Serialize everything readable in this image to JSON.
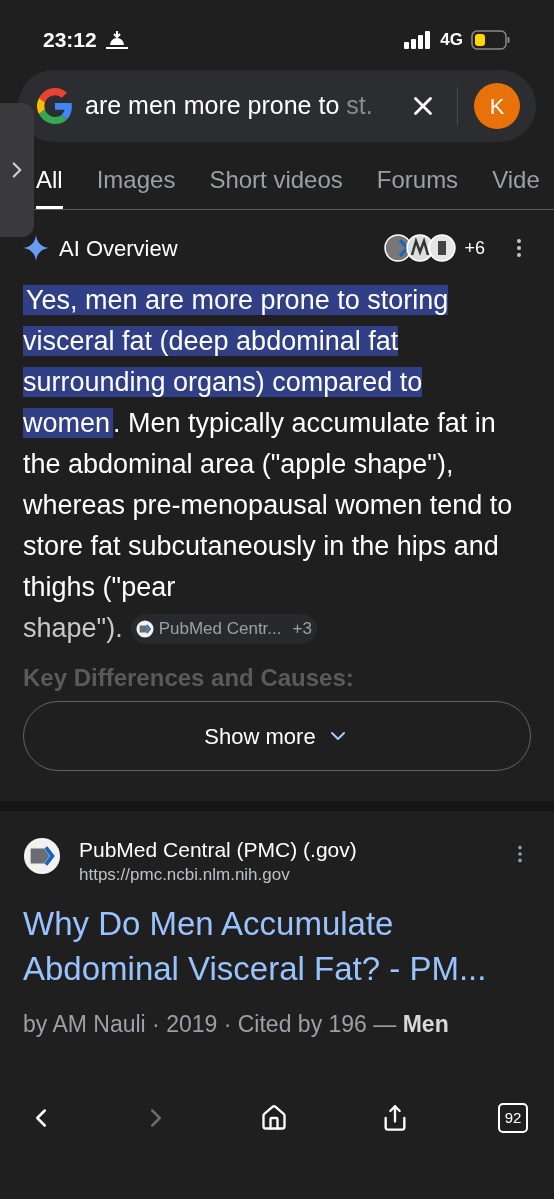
{
  "status_bar": {
    "time": "23:12",
    "network": "4G"
  },
  "search": {
    "query": "are men more prone to ",
    "query_faded": "st.",
    "avatar_letter": "K"
  },
  "tabs": [
    {
      "label": "All",
      "selected": true
    },
    {
      "label": "Images",
      "selected": false
    },
    {
      "label": "Short videos",
      "selected": false
    },
    {
      "label": "Forums",
      "selected": false
    },
    {
      "label": "Vide",
      "selected": false
    }
  ],
  "ai_overview": {
    "title": "AI Overview",
    "sources_more": "+6",
    "highlighted": "Yes, men are more prone to storing visceral fat (deep abdominal fat surrounding organs) compared to women",
    "rest": ". Men typically accumulate fat in the abdominal area (\"apple shape\"), whereas pre-menopausal women tend to store fat subcutaneously in the hips and thighs (\"pear",
    "tail": "shape\").",
    "citation": {
      "source": "PubMed Centr...",
      "more": "+3"
    },
    "faded_heading": "Key Differences and Causes:",
    "show_more": "Show more"
  },
  "result": {
    "site": "PubMed Central (PMC) (.gov)",
    "url": "https://pmc.ncbi.nlm.nih.gov",
    "title": "Why Do Men Accumulate Abdominal Visceral Fat? - PM...",
    "snippet": "by AM Nauli · 2019 · Cited by 196 — **Men**"
  },
  "toolbar": {
    "tab_count": "92",
    "forward_disabled": true
  }
}
